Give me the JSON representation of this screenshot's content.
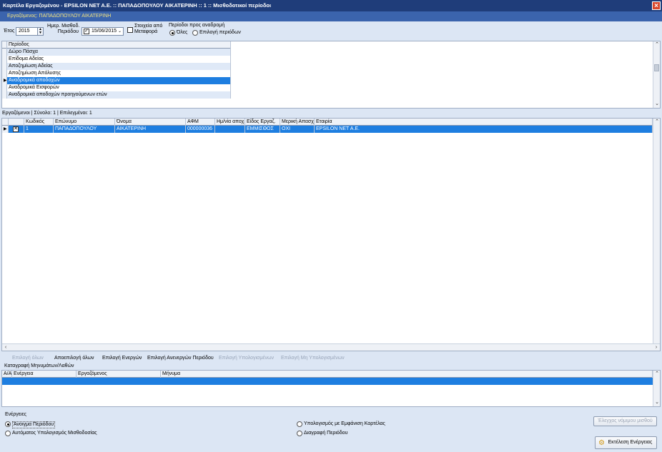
{
  "window": {
    "title": "Καρτέλα Εργαζομένου - EPSILON NET A.E. :: ΠΑΠΑΔΟΠΟΥΛΟΥ ΑΙΚΑΤΕΡΙΝΗ :: 1 :: Μισθοδοτικοί περίοδοι",
    "close_glyph": "×",
    "employee_label": "Εργαζόμενος: ΠΑΠΑΔΟΠΟΥΛΟΥ ΑΙΚΑΤΕΡΙΝΗ"
  },
  "toolbar": {
    "year_label": "Έτος",
    "year_value": "2015",
    "pay_date_label_1": "Ημερ. Μισθοδ.",
    "pay_date_label_2": "Περιόδου",
    "pay_date_checked": true,
    "pay_date_value": "15/06/2015",
    "transfer_label_1": "Στοιχεία από",
    "transfer_label_2": "Μεταφορά",
    "transfer_checked": false,
    "periods_label": "Περίοδοι προς αναδρομή",
    "radio_all": "Όλες",
    "radio_select": "Επιλογή περιόδων",
    "radio_selected": "all"
  },
  "periods": {
    "header": "Περίοδος",
    "rows": [
      "Δώρο Πάσχα",
      "Επίδομα Αδείας",
      "Αποζημίωση Αδείας",
      "Αποζημίωση Απόλυσης",
      "Αναδρομικά αποδοχών",
      "Αναδρομικά Εισφορών",
      "Αναδρομικά αποδοχών προηγούμενων ετών"
    ],
    "selected_index": 4
  },
  "employees": {
    "summary": "Εργαζόμενοι | Σύνολο:     1 | Επιλεγμένοι:    1",
    "columns": [
      "Κωδικός",
      "Επώνυμο",
      "Όνομα",
      "ΑΦΜ",
      "Ημ/νία αποχ.",
      "Είδος Εργαζ.",
      "Μερική Απασχ.",
      "Εταιρία"
    ],
    "rows": [
      {
        "checked": "✕",
        "code": "1",
        "surname": "ΠΑΠΑΔΟΠΟΥΛΟΥ",
        "name": "ΑΙΚΑΤΕΡΙΝΗ",
        "afm": "000000036",
        "leave_date": "",
        "type": "ΕΜΜΙΣΘΟΣ",
        "part_time": "ΟΧΙ",
        "company": "EPSILON NET A.E."
      }
    ]
  },
  "actions_bar": {
    "select_all": "Επιλογή όλων",
    "deselect_all": "Αποεπιλογή όλων",
    "select_active": "Επιλογή Ενεργών",
    "select_inactive": "Επιλογή Ανενεργών Περιόδου",
    "select_calculated": "Επιλογή Υπολογισμένων",
    "select_not_calculated": "Επιλογή Μη Υπολογισμένων"
  },
  "messages": {
    "title": "Καταγραφή Μηνυμάτων/Λαθών",
    "columns": [
      "Α/Α",
      "Ενέργεια",
      "Εργαζόμενος",
      "Μήνυμα"
    ]
  },
  "operations": {
    "title": "Ενέργειες",
    "open_period": "Άνοιγμα Περιόδου",
    "auto_calc": "Αυτόματος Υπολογισμός Μισθοδοσίας",
    "calc_show": "Υπολογισμός με Εμφάνιση Καρτέλας",
    "delete_period": "Διαγραφή Περιόδου",
    "selected": "open_period",
    "law_check_button": "Έλεγχος νόμιμου μισθού",
    "execute_button": "Εκτέλεση Ενέργειας"
  }
}
